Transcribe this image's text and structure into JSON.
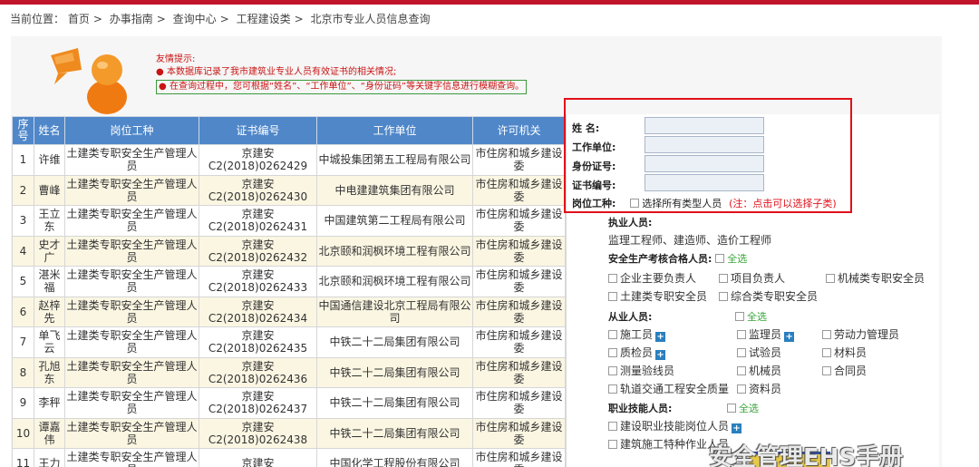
{
  "breadcrumb": {
    "label": "当前位置：",
    "items": [
      "首页",
      "办事指南",
      "查询中心",
      "工程建设类",
      "北京市专业人员信息查询"
    ],
    "separator": ">"
  },
  "tips": {
    "title": "友情提示:",
    "line1": "本数据库记录了我市建筑业专业人员有效证书的相关情况;",
    "line2": "在查询过程中，您可根据“姓名”、“工作单位”、“身份证码”等关键字信息进行模糊查询。"
  },
  "table": {
    "headers": [
      "序号",
      "姓名",
      "岗位工种",
      "证书编号",
      "工作单位",
      "许可机关"
    ],
    "rows": [
      [
        "1",
        "许维",
        "土建类专职安全生产管理人员",
        "京建安C2(2018)0262429",
        "中城投集团第五工程局有限公司",
        "市住房和城乡建设委"
      ],
      [
        "2",
        "曹峰",
        "土建类专职安全生产管理人员",
        "京建安C2(2018)0262430",
        "中电建建筑集团有限公司",
        "市住房和城乡建设委"
      ],
      [
        "3",
        "王立东",
        "土建类专职安全生产管理人员",
        "京建安C2(2018)0262431",
        "中国建筑第二工程局有限公司",
        "市住房和城乡建设委"
      ],
      [
        "4",
        "史才广",
        "土建类专职安全生产管理人员",
        "京建安C2(2018)0262432",
        "北京颐和润枫环境工程有限公司",
        "市住房和城乡建设委"
      ],
      [
        "5",
        "湛米福",
        "土建类专职安全生产管理人员",
        "京建安C2(2018)0262433",
        "北京颐和润枫环境工程有限公司",
        "市住房和城乡建设委"
      ],
      [
        "6",
        "赵梓先",
        "土建类专职安全生产管理人员",
        "京建安C2(2018)0262434",
        "中国通信建设北京工程局有限公司",
        "市住房和城乡建设委"
      ],
      [
        "7",
        "单飞云",
        "土建类专职安全生产管理人员",
        "京建安C2(2018)0262435",
        "中铁二十二局集团有限公司",
        "市住房和城乡建设委"
      ],
      [
        "8",
        "孔旭东",
        "土建类专职安全生产管理人员",
        "京建安C2(2018)0262436",
        "中铁二十二局集团有限公司",
        "市住房和城乡建设委"
      ],
      [
        "9",
        "李秤",
        "土建类专职安全生产管理人员",
        "京建安C2(2018)0262437",
        "中铁二十二局集团有限公司",
        "市住房和城乡建设委"
      ],
      [
        "10",
        "谭嘉伟",
        "土建类专职安全生产管理人员",
        "京建安C2(2018)0262438",
        "中铁二十二局集团有限公司",
        "市住房和城乡建设委"
      ],
      [
        "11",
        "王力",
        "土建类专职安全生产管理人员",
        "京建安",
        "中国化学工程股份有限公司",
        "市住房和城乡建设委"
      ]
    ]
  },
  "form": {
    "name_label": "姓    名:",
    "unit_label": "工作单位:",
    "id_label": "身份证号:",
    "cert_label": "证书编号:",
    "position_label": "岗位工种:",
    "select_all_types": "选择所有类型人员",
    "note": "(注：点击可以选择子类)"
  },
  "categories": {
    "licensed": {
      "title": "执业人员:",
      "items": "监理工程师、建造师、造价工程师"
    },
    "safety": {
      "title": "安全生产考核合格人员:",
      "select_all": "全选",
      "items": [
        "企业主要负责人",
        "项目负责人",
        "机械类专职安全员",
        "土建类专职安全员",
        "综合类专职安全员"
      ]
    },
    "practitioners": {
      "title": "从业人员:",
      "select_all": "全选",
      "items": [
        "施工员",
        "监理员",
        "劳动力管理员",
        "质检员",
        "试验员",
        "材料员",
        "测量验线员",
        "机械员",
        "合同员",
        "轨道交通工程安全质量",
        "资料员"
      ]
    },
    "skills": {
      "title": "职业技能人员:",
      "select_all": "全选",
      "items": [
        "建设职业技能岗位人员",
        "建筑施工特种作业人员"
      ]
    }
  },
  "watermark": "安全管理EHS手册",
  "colors": {
    "topbar": "#c0142b",
    "table_header": "#4f87c9",
    "row_alt": "#fbf6e2",
    "highlight_border": "#e0101a",
    "select_all_green": "#3aa53a",
    "tip_red": "#c81414"
  }
}
